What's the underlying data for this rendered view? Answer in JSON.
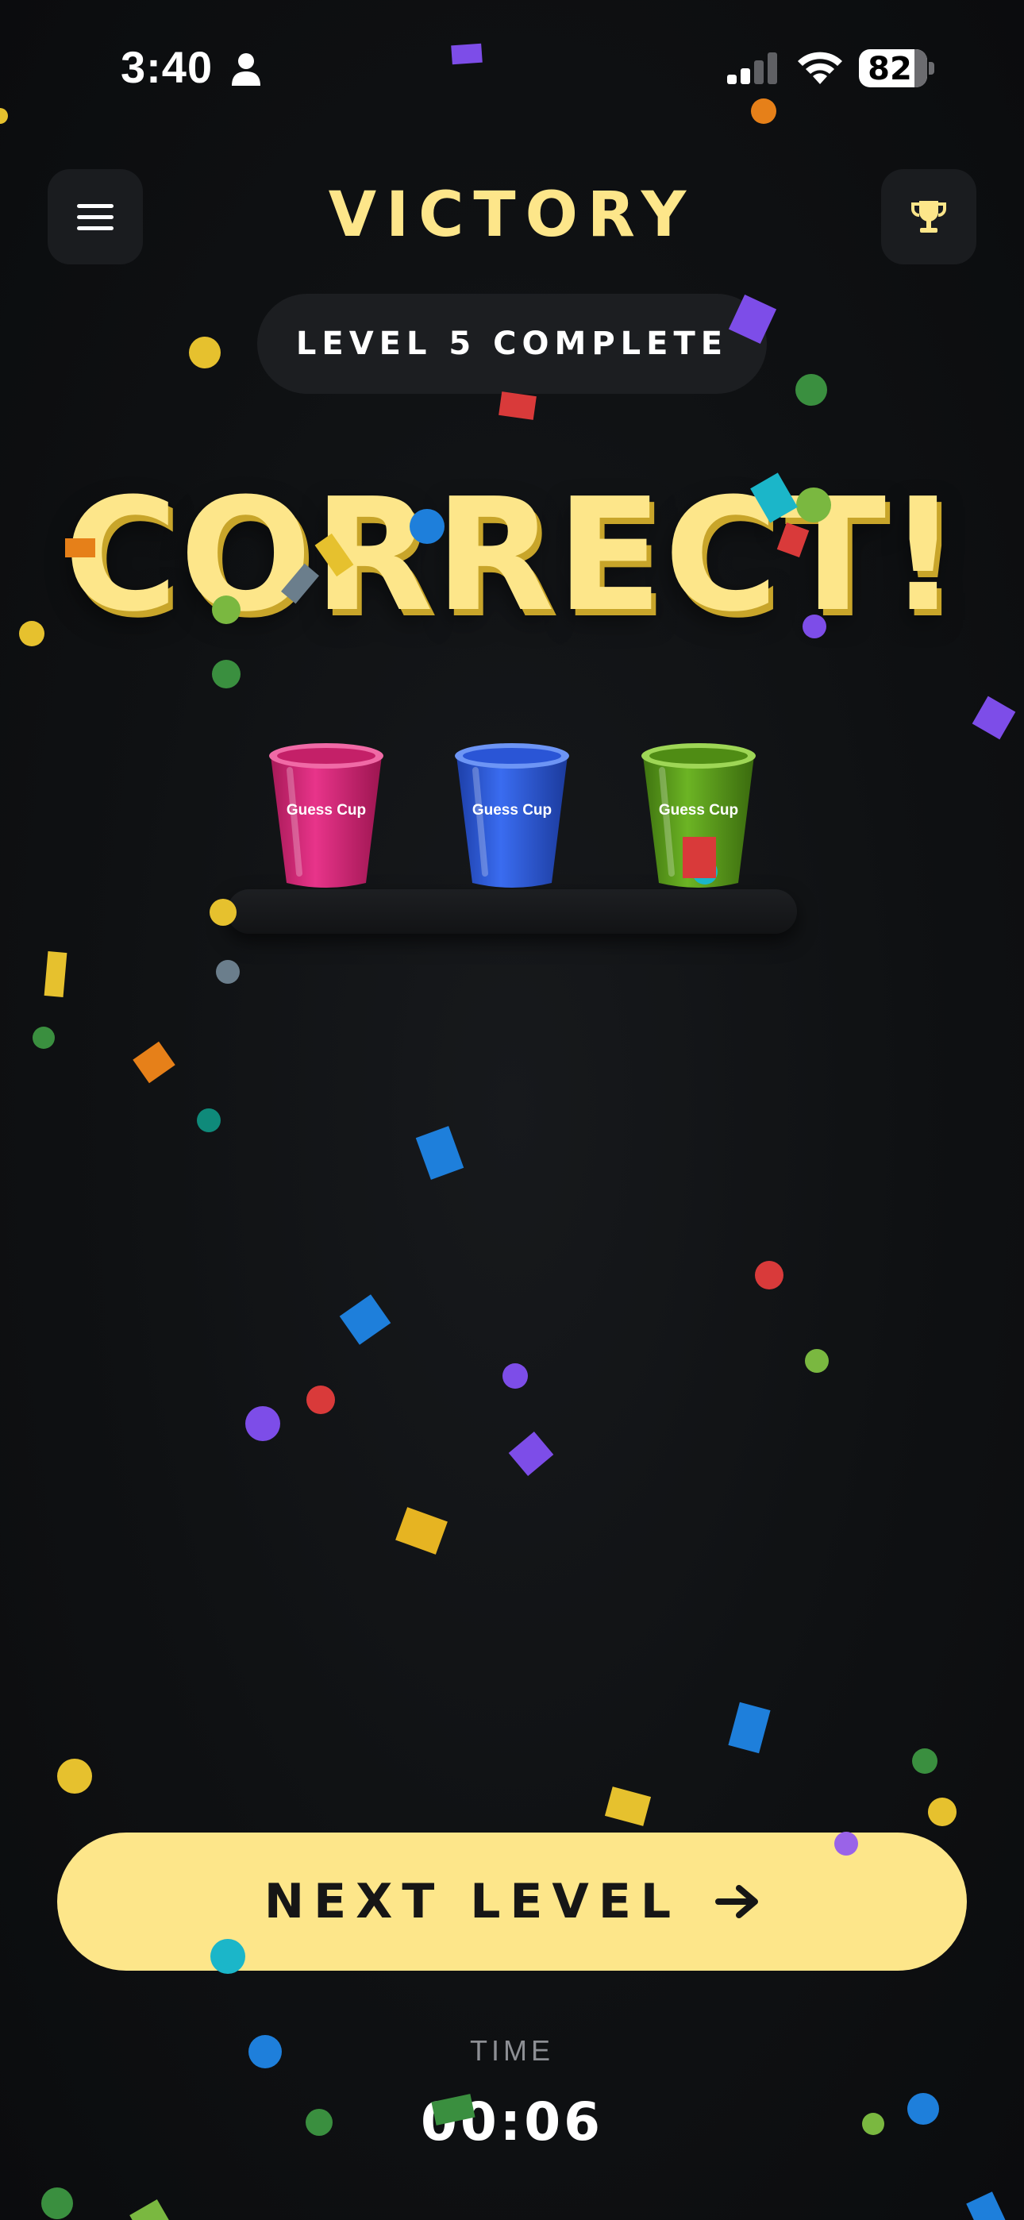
{
  "status_bar": {
    "time": "3:40",
    "battery": "82",
    "icons": [
      "person-icon",
      "signal-icon",
      "wifi-icon",
      "battery-icon"
    ]
  },
  "header": {
    "title": "VICTORY",
    "menu_icon": "hamburger-icon",
    "trophy_icon": "trophy-icon"
  },
  "level_badge": "LEVEL 5 COMPLETE",
  "result_text": "CORRECT!",
  "cups": [
    {
      "label": "Guess Cup",
      "color": "#e02e7d"
    },
    {
      "label": "Guess Cup",
      "color": "#2c5ee8"
    },
    {
      "label": "Guess Cup",
      "color": "#5aa01a"
    }
  ],
  "next_button": {
    "label": "NEXT LEVEL",
    "icon": "arrow-right-icon"
  },
  "timer": {
    "label": "TIME",
    "value": "00:06"
  },
  "colors": {
    "accent": "#fde68a",
    "background": "#0f1113",
    "confetti": [
      "#e6c12e",
      "#3a8f3f",
      "#1e7fdb",
      "#7d4de8",
      "#d93a3a",
      "#e68019",
      "#1bb6c9",
      "#7ab840",
      "#0f8a7a",
      "#6b7e8c"
    ]
  }
}
